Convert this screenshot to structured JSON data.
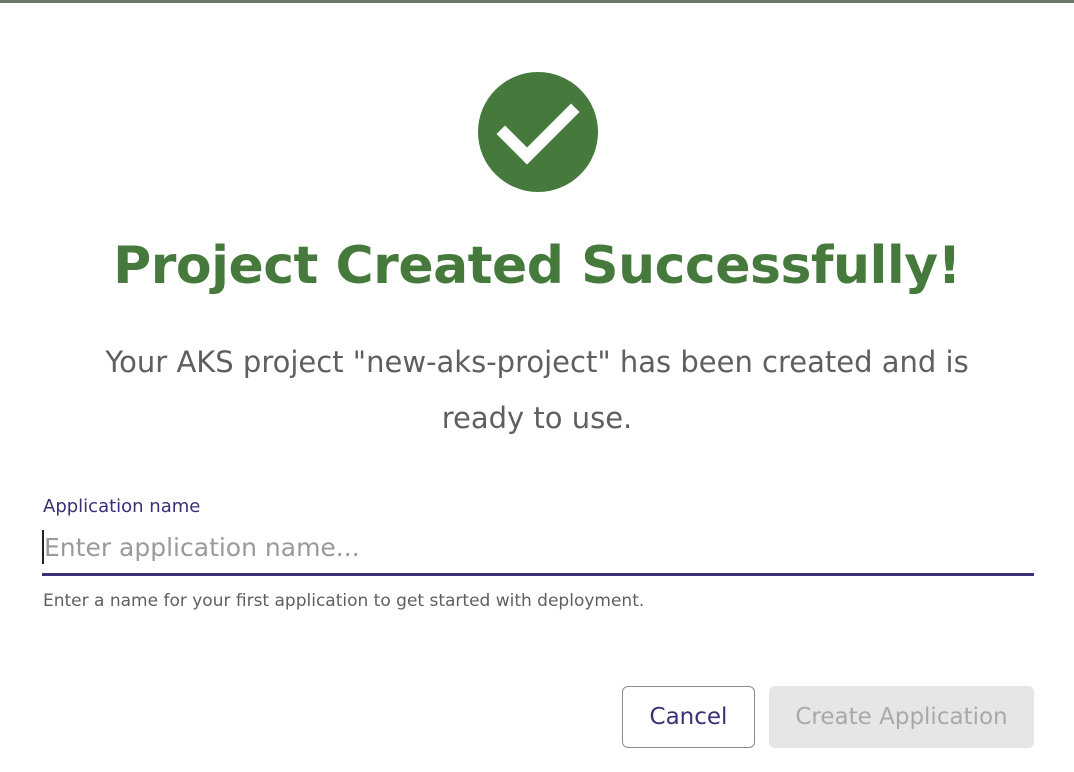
{
  "dialog": {
    "success_icon": "check-circle-icon",
    "title": "Project Created Successfully!",
    "message": "Your AKS project \"new-aks-project\" has been created and is ready to use.",
    "form": {
      "label": "Application name",
      "value": "",
      "placeholder": "Enter application name...",
      "helper_text": "Enter a name for your first application to get started with deployment."
    },
    "actions": {
      "cancel_label": "Cancel",
      "create_label": "Create Application",
      "create_disabled": true
    }
  },
  "colors": {
    "success": "#457a3c",
    "accent": "#3b2f75",
    "text_muted": "#5f5f5f",
    "disabled_bg": "#e6e6e6",
    "disabled_text": "#a9a9a9"
  }
}
